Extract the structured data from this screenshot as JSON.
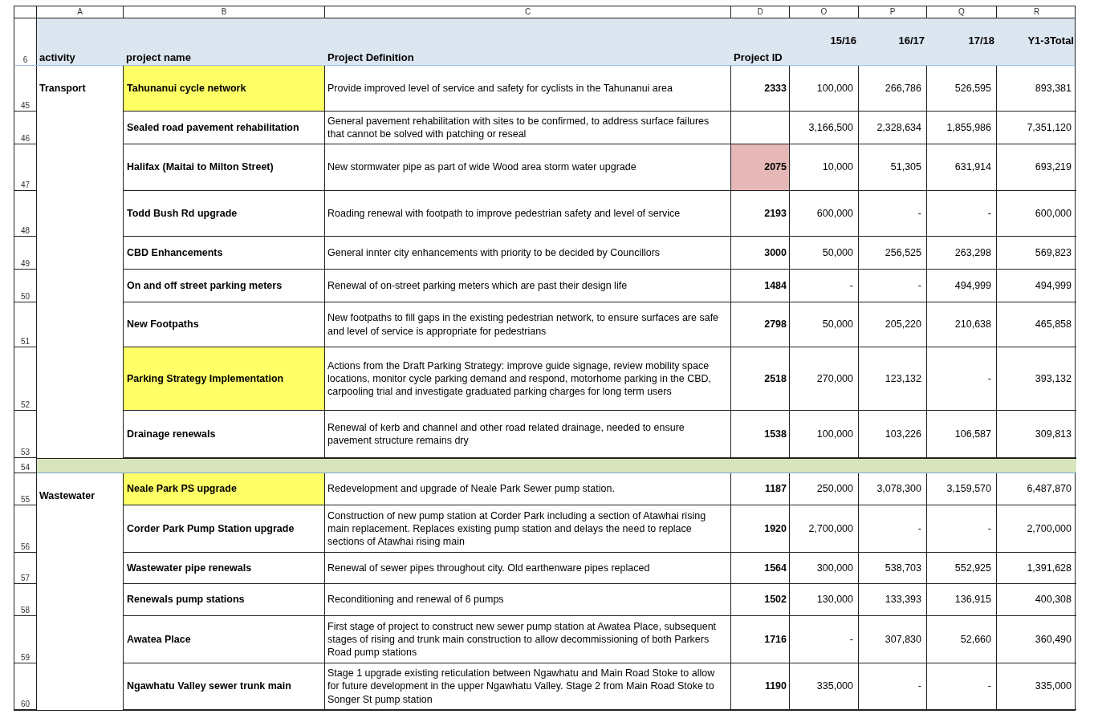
{
  "column_letters": [
    "A",
    "B",
    "C",
    "D",
    "O",
    "P",
    "Q",
    "R"
  ],
  "header": {
    "row_number": "6",
    "activity": "activity",
    "name": "project name",
    "definition": "Project Definition",
    "project_id": "Project ID",
    "years": [
      "15/16",
      "16/17",
      "17/18"
    ],
    "total": "Y1-3Total"
  },
  "rows": [
    {
      "kind": "project",
      "row_number": "45",
      "activity": "Transport",
      "name": "Tahunanui cycle network",
      "highlighted": true,
      "definition": "Provide improved level of service and safety for cyclists in the Tahunanui area",
      "project_id": "2333",
      "id_flagged": false,
      "values": [
        "100,000",
        "266,786",
        "526,595",
        "893,381"
      ]
    },
    {
      "kind": "project",
      "row_number": "46",
      "name": "Sealed road pavement rehabilitation",
      "highlighted": false,
      "definition": "General pavement rehabilitation with sites to be confirmed, to address surface failures that cannot be solved with patching or reseal",
      "id_flagged": false,
      "values": [
        "3,166,500",
        "2,328,634",
        "1,855,986",
        "7,351,120"
      ]
    },
    {
      "kind": "project",
      "row_number": "47",
      "name": "Halifax (Maitai to Milton Street)",
      "highlighted": false,
      "definition": "New stormwater pipe as part of wide Wood area storm water upgrade",
      "project_id": "2075",
      "id_flagged": true,
      "values": [
        "10,000",
        "51,305",
        "631,914",
        "693,219"
      ]
    },
    {
      "kind": "project",
      "row_number": "48",
      "name": "Todd Bush Rd upgrade",
      "highlighted": false,
      "definition": "Roading renewal with footpath to improve pedestrian safety and level of service",
      "project_id": "2193",
      "id_flagged": false,
      "values": [
        "600,000",
        "-",
        "-",
        "600,000"
      ]
    },
    {
      "kind": "project",
      "row_number": "49",
      "name": "CBD Enhancements",
      "highlighted": false,
      "definition": "General innter city enhancements with priority to be decided by Councillors",
      "project_id": "3000",
      "id_flagged": false,
      "values": [
        "50,000",
        "256,525",
        "263,298",
        "569,823"
      ]
    },
    {
      "kind": "project",
      "row_number": "50",
      "name": "On and off street parking meters",
      "highlighted": false,
      "definition": "Renewal of on-street parking meters which are past their design life",
      "project_id": "1484",
      "id_flagged": false,
      "values": [
        "-",
        "-",
        "494,999",
        "494,999"
      ]
    },
    {
      "kind": "project",
      "row_number": "51",
      "name": "New Footpaths",
      "highlighted": false,
      "definition": "New footpaths to fill gaps in the existing pedestrian network, to ensure surfaces are safe and level of service is appropriate for pedestrians",
      "project_id": "2798",
      "id_flagged": false,
      "values": [
        "50,000",
        "205,220",
        "210,638",
        "465,858"
      ]
    },
    {
      "kind": "project",
      "row_number": "52",
      "name": "Parking Strategy Implementation",
      "highlighted": true,
      "definition": "Actions from the Draft Parking Strategy:  improve guide signage, review mobility space locations, monitor cycle parking demand and respond, motorhome parking in the CBD, carpooling trial and investigate graduated parking charges for long term users",
      "project_id": "2518",
      "id_flagged": false,
      "values": [
        "270,000",
        "123,132",
        "-",
        "393,132"
      ]
    },
    {
      "kind": "project",
      "row_number": "53",
      "name": "Drainage renewals",
      "highlighted": false,
      "definition": "Renewal of kerb and channel and other road related drainage, needed to ensure pavement structure remains dry",
      "project_id": "1538",
      "id_flagged": false,
      "values": [
        "100,000",
        "103,226",
        "106,587",
        "309,813"
      ]
    },
    {
      "kind": "separator",
      "row_number": "54"
    },
    {
      "kind": "project",
      "row_number": "55",
      "activity": "Wastewater",
      "name": "Neale Park PS upgrade",
      "highlighted": true,
      "definition": "Redevelopment and upgrade of Neale Park Sewer pump station.",
      "project_id": "1187",
      "id_flagged": false,
      "values": [
        "250,000",
        "3,078,300",
        "3,159,570",
        "6,487,870"
      ]
    },
    {
      "kind": "project",
      "row_number": "56",
      "name": "Corder Park Pump Station upgrade",
      "highlighted": false,
      "definition": "Construction of new pump station at Corder Park including a section of Atawhai rising main replacement. Replaces existing pump station and delays the need to replace sections of Atawhai rising main",
      "project_id": "1920",
      "id_flagged": false,
      "values": [
        "2,700,000",
        "-",
        "-",
        "2,700,000"
      ]
    },
    {
      "kind": "project",
      "row_number": "57",
      "name": "Wastewater pipe renewals",
      "highlighted": false,
      "definition": "Renewal of sewer pipes throughout city. Old earthenware pipes replaced",
      "project_id": "1564",
      "id_flagged": false,
      "values": [
        "300,000",
        "538,703",
        "552,925",
        "1,391,628"
      ]
    },
    {
      "kind": "project",
      "row_number": "58",
      "name": "Renewals pump stations",
      "highlighted": false,
      "definition": "Reconditioning and renewal of 6 pumps",
      "project_id": "1502",
      "id_flagged": false,
      "values": [
        "130,000",
        "133,393",
        "136,915",
        "400,308"
      ]
    },
    {
      "kind": "project",
      "row_number": "59",
      "name": "Awatea Place",
      "highlighted": false,
      "definition": "First stage of project to construct new sewer pump station at Awatea Place, subsequent stages of rising and trunk main construction to allow decommissioning of both Parkers Road pump stations",
      "project_id": "1716",
      "id_flagged": false,
      "values": [
        "-",
        "307,830",
        "52,660",
        "360,490"
      ]
    },
    {
      "kind": "project",
      "row_number": "60",
      "name": "Ngawhatu Valley sewer trunk main",
      "highlighted": false,
      "definition": "Stage 1 upgrade existing reticulation between Ngawhatu and Main Road Stoke to allow for future development in the upper Ngawhatu Valley. Stage 2 from Main Road Stoke to Songer St pump station",
      "project_id": "1190",
      "id_flagged": false,
      "values": [
        "335,000",
        "-",
        "-",
        "335,000"
      ]
    }
  ]
}
